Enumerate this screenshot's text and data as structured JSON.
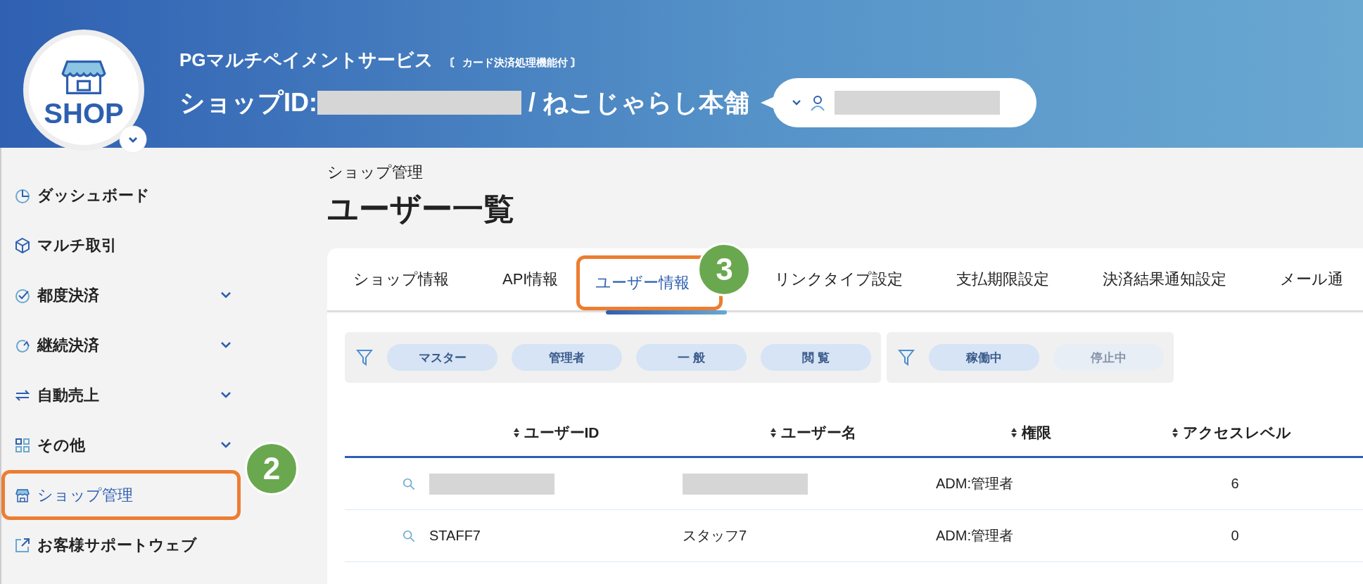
{
  "header": {
    "service": "PGマルチペイメントサービス",
    "service_note": "〘 カード決済処理機能付 〙",
    "shop_id_label": "ショップID:",
    "shop_id": {
      "kind": "redacted"
    },
    "shop_name": "/ ねこじゃらし本舗",
    "logo_text": "SHOP",
    "user": {
      "kind": "redacted"
    }
  },
  "sidebar": {
    "items": [
      {
        "label": "ダッシュボード",
        "expandable": false,
        "selected": false
      },
      {
        "label": "マルチ取引",
        "expandable": false,
        "selected": false
      },
      {
        "label": "都度決済",
        "expandable": true,
        "selected": false
      },
      {
        "label": "継続決済",
        "expandable": true,
        "selected": false
      },
      {
        "label": "自動売上",
        "expandable": true,
        "selected": false
      },
      {
        "label": "その他",
        "expandable": true,
        "selected": false
      },
      {
        "label": "ショップ管理",
        "expandable": false,
        "selected": true,
        "callout": "2"
      },
      {
        "label": "お客様サポートウェブ",
        "expandable": false,
        "selected": false
      }
    ]
  },
  "breadcrumb": "ショップ管理",
  "page_title": "ユーザー一覧",
  "tabs": [
    {
      "label": "ショップ情報",
      "selected": false
    },
    {
      "label": "API情報",
      "selected": false
    },
    {
      "label": "ユーザー情報",
      "selected": true,
      "callout": "3"
    },
    {
      "label": "リンクタイプ設定",
      "selected": false
    },
    {
      "label": "支払期限設定",
      "selected": false
    },
    {
      "label": "決済結果通知設定",
      "selected": false
    },
    {
      "label": "メール通",
      "selected": false
    }
  ],
  "filters": [
    {
      "chips": [
        {
          "label": "マスター",
          "on": true
        },
        {
          "label": "管理者",
          "on": true
        },
        {
          "label": "一 般",
          "on": true
        },
        {
          "label": "閲 覧",
          "on": true
        }
      ]
    },
    {
      "chips": [
        {
          "label": "稼働中",
          "on": true
        },
        {
          "label": "停止中",
          "on": false
        }
      ]
    }
  ],
  "table": {
    "columns": [
      "ユーザーID",
      "ユーザー名",
      "権限",
      "アクセスレベル"
    ],
    "rows": [
      {
        "cells": [
          {
            "kind": "redacted"
          },
          {
            "kind": "redacted"
          },
          {
            "kind": "text",
            "text": "ADM:管理者"
          },
          {
            "kind": "text",
            "text": "6"
          }
        ]
      },
      {
        "cells": [
          {
            "kind": "text",
            "text": "STAFF7"
          },
          {
            "kind": "text",
            "text": "スタッフ7"
          },
          {
            "kind": "text",
            "text": "ADM:管理者"
          },
          {
            "kind": "text",
            "text": "0"
          }
        ]
      }
    ]
  }
}
